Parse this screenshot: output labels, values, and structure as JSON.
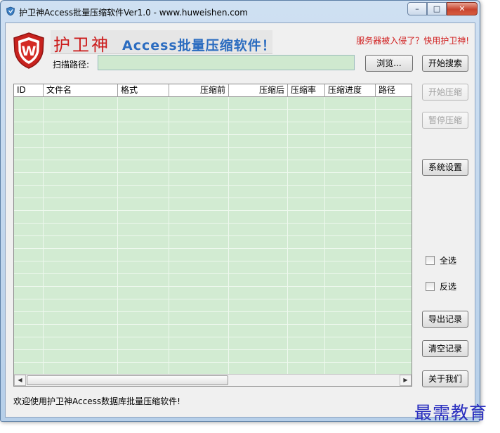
{
  "window": {
    "title": "护卫神Access批量压缩软件Ver1.0 - www.huweishen.com",
    "minimize_label": "–",
    "maximize_label": "□",
    "close_label": "✕"
  },
  "brand": {
    "logo_letter": "W",
    "name": "护卫神",
    "product": "Access批量压缩软件！",
    "slogan": "服务器被入侵了？快用护卫神!"
  },
  "scan": {
    "label": "扫描路径:",
    "value": ""
  },
  "buttons": {
    "browse": "浏览...",
    "start_search": "开始搜索",
    "start_compress": "开始压缩",
    "pause_compress": "暂停压缩",
    "settings": "系统设置",
    "export_log": "导出记录",
    "clear_log": "清空记录",
    "about": "关于我们"
  },
  "table": {
    "columns": [
      "ID",
      "文件名",
      "格式",
      "压缩前",
      "压缩后",
      "压缩率",
      "压缩进度",
      "路径"
    ],
    "rows": []
  },
  "checkboxes": {
    "select_all": "全选",
    "invert": "反选"
  },
  "status": {
    "message": "欢迎使用护卫神Access数据库批量压缩软件!"
  },
  "watermark": "最需教育",
  "scrollbar": {
    "left_arrow": "◀",
    "right_arrow": "▶"
  },
  "colors": {
    "brand_red": "#cc1b1b",
    "brand_blue": "#2b6cc0",
    "grid_green": "#d2ebd2",
    "watermark_blue": "#2a2fbf"
  }
}
